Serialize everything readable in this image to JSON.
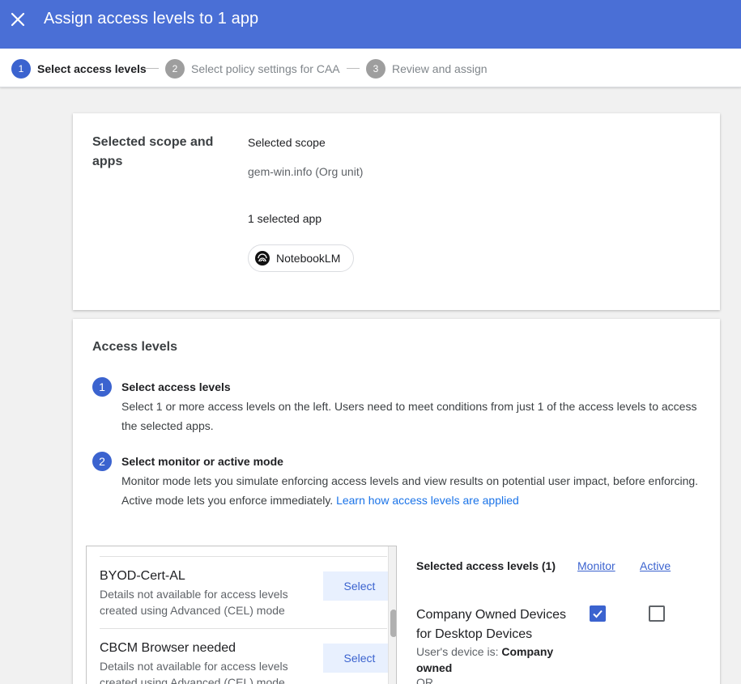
{
  "header": {
    "title": "Assign access levels to 1 app",
    "close_icon": "close-icon"
  },
  "stepper": {
    "steps": [
      {
        "number": "1",
        "label": "Select access levels",
        "active": true
      },
      {
        "number": "2",
        "label": "Select policy settings for CAA",
        "active": false
      },
      {
        "number": "3",
        "label": "Review and assign",
        "active": false
      }
    ]
  },
  "scope_card": {
    "heading": "Selected scope and apps",
    "scope_label": "Selected scope",
    "scope_value": "gem-win.info (Org unit)",
    "apps_label": "1 selected app",
    "app_chip": {
      "label": "NotebookLM",
      "icon": "notebooklm-icon"
    }
  },
  "access_card": {
    "title": "Access levels",
    "instructions": [
      {
        "number": "1",
        "title": "Select access levels",
        "body": "Select 1 or more access levels on the left. Users need to meet conditions from just 1 of the access levels to access the selected apps."
      },
      {
        "number": "2",
        "title": "Select monitor or active mode",
        "body": "Monitor mode lets you simulate enforcing access levels and view results on potential user impact, before enforcing. Active mode lets you enforce immediately.",
        "link": "Learn how access levels are applied"
      }
    ],
    "available_levels": [
      {
        "name": "BYOD-Cert-AL",
        "description": "Details not available for access levels created using Advanced (CEL) mode",
        "button": "Select"
      },
      {
        "name": "CBCM Browser needed",
        "description": "Details not available for access levels created using Advanced (CEL) mode",
        "button": "Select"
      }
    ],
    "selected": {
      "header": "Selected access levels (1)",
      "monitor_label": "Monitor",
      "active_label": "Active",
      "items": [
        {
          "name": "Company Owned Devices for Desktop Devices",
          "condition_prefix": "User's device is: ",
          "condition_value": "Company owned",
          "or_text": "OR",
          "monitor": true,
          "active": false
        }
      ]
    }
  },
  "colors": {
    "header_bg": "#4a6fd6",
    "accent": "#3b63cf",
    "link": "#1a73e8"
  }
}
